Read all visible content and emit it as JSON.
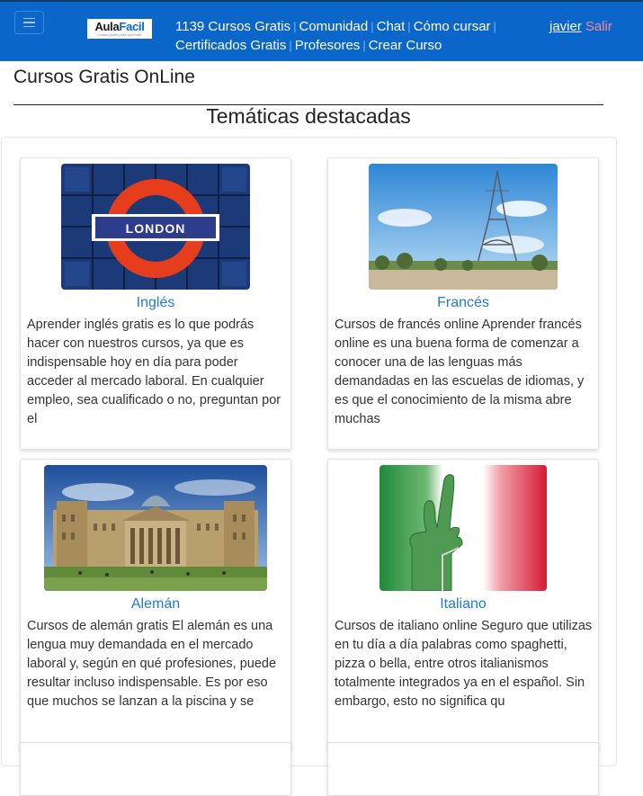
{
  "navbar": {
    "logo_text_a": "Aula",
    "logo_text_b": "Facil",
    "logo_tagline": "cursos gratis para aprender",
    "links": [
      "1139 Cursos Gratis",
      "Comunidad",
      "Chat",
      "Cómo cursar",
      "Certificados Gratis",
      "Profesores",
      "Crear Curso"
    ],
    "user": "javier",
    "logout": "Salir"
  },
  "page_title": "Cursos Gratis OnLine",
  "section_heading": "Temáticas destacadas",
  "cards": [
    {
      "title": "Inglés",
      "image_sign": "LONDON",
      "description": "Aprender inglés gratis es lo que podrás hacer con nuestros cursos, ya que es indispensable hoy en día para poder acceder al mercado laboral. En cualquier empleo, sea cualificado o no, preguntan por el"
    },
    {
      "title": "Francés",
      "description": "Cursos de francés online Aprender francés online es una buena forma de comenzar a conocer una de las lenguas más demandadas en las escuelas de idiomas, y es que el conocimiento de la misma abre muchas"
    },
    {
      "title": "Alemán",
      "description": "Cursos de alemán gratis El alemán es una lengua muy demandada en el mercado laboral y, según en qué profesiones, puede resultar incluso indispensable. Es por eso que muchos se lanzan a la piscina y se"
    },
    {
      "title": "Italiano",
      "description": "Cursos de italiano online Seguro que utilizas en tu día a día palabras como spaghetti, pizza o bella, entre otros italianismos totalmente integrados ya en el español. Sin embargo, esto no significa qu"
    }
  ],
  "colors": {
    "navbar_bg": "#0a66c8",
    "link_blue": "#1f7bd4",
    "logout_pink": "#f08aa4"
  }
}
